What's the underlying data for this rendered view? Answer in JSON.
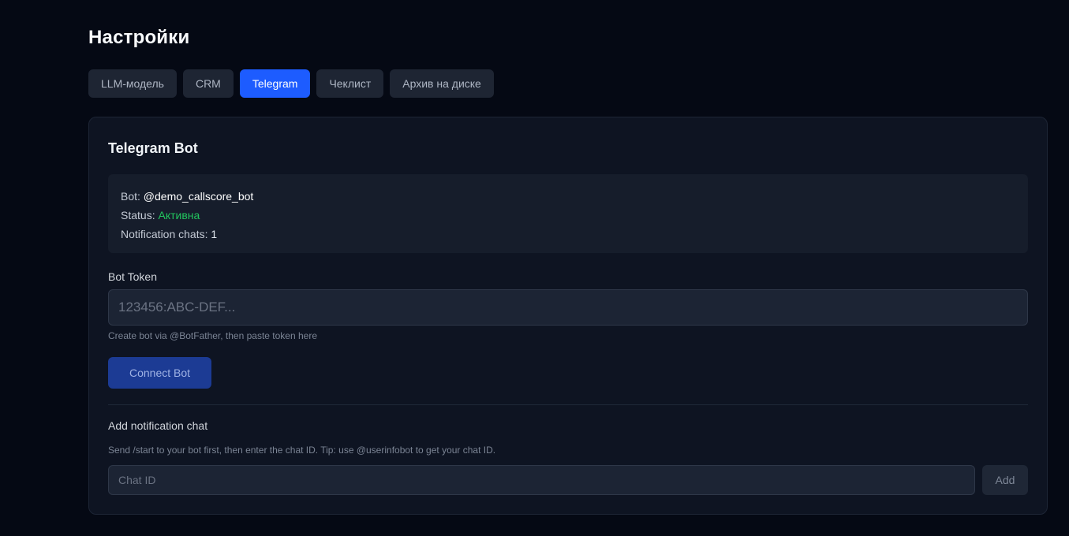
{
  "page": {
    "title": "Настройки"
  },
  "tabs": [
    {
      "label": "LLM-модель",
      "active": false
    },
    {
      "label": "CRM",
      "active": false
    },
    {
      "label": "Telegram",
      "active": true
    },
    {
      "label": "Чеклист",
      "active": false
    },
    {
      "label": "Архив на диске",
      "active": false
    }
  ],
  "telegram": {
    "card_title": "Telegram Bot",
    "info": {
      "bot_label": "Bot:",
      "bot_value": "@demo_callscore_bot",
      "status_label": "Status:",
      "status_value": "Активна",
      "chats_label": "Notification chats:",
      "chats_value": "1"
    },
    "token": {
      "label": "Bot Token",
      "placeholder": "123456:ABC-DEF...",
      "value": "",
      "hint": "Create bot via @BotFather, then paste token here"
    },
    "connect_label": "Connect Bot",
    "chat": {
      "label": "Add notification chat",
      "hint": "Send /start to your bot first, then enter the chat ID. Tip: use @userinfobot to get your chat ID.",
      "placeholder": "Chat ID",
      "value": "",
      "add_label": "Add"
    }
  },
  "colors": {
    "background": "#050914",
    "card": "#0e1422",
    "accent": "#1d5cff",
    "status_active": "#22c55e"
  }
}
